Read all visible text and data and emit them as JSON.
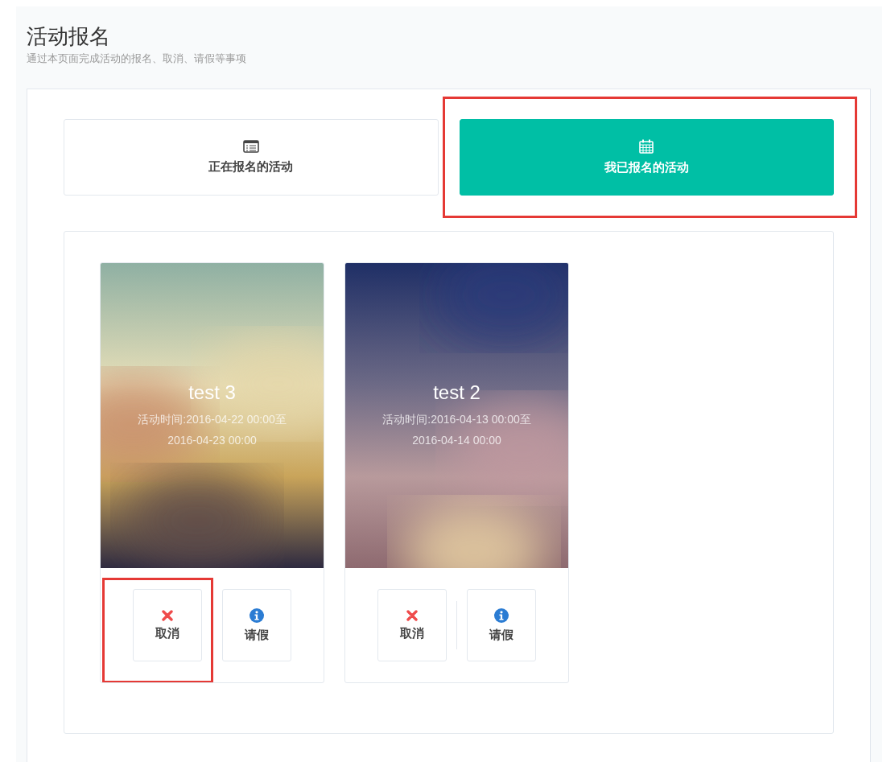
{
  "header": {
    "title": "活动报名",
    "subtitle": "通过本页面完成活动的报名、取消、请假等事项"
  },
  "tabs": [
    {
      "label": "正在报名的活动",
      "kind": "list",
      "selected": false,
      "highlighted": false
    },
    {
      "label": "我已报名的活动",
      "kind": "calendar",
      "selected": true,
      "highlighted": true
    }
  ],
  "cards": [
    {
      "title": "test 3",
      "time": "活动时间:2016-04-22 00:00至2016-04-23 00:00",
      "actions": [
        {
          "label": "取消",
          "kind": "cancel",
          "highlighted": true
        },
        {
          "label": "请假",
          "kind": "leave",
          "highlighted": false
        }
      ]
    },
    {
      "title": "test 2",
      "time": "活动时间:2016-04-13 00:00至2016-04-14 00:00",
      "actions": [
        {
          "label": "取消",
          "kind": "cancel",
          "highlighted": false
        },
        {
          "label": "请假",
          "kind": "leave",
          "highlighted": false
        }
      ]
    }
  ]
}
